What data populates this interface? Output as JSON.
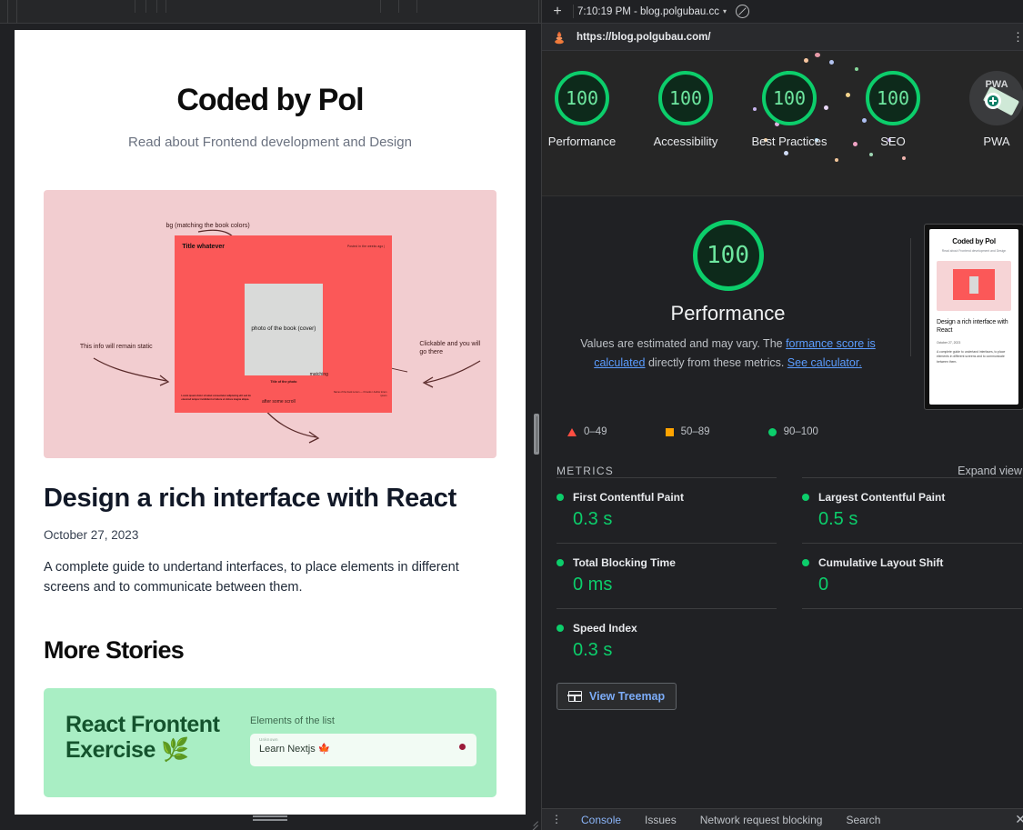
{
  "devtools": {
    "tabbar": {
      "new_tab": "+",
      "run_title": "7:10:19 PM - blog.polgubau.cc",
      "caret": "▾",
      "block_icon": "no-entry-icon"
    },
    "urlbar": {
      "url": "https://blog.polgubau.com/",
      "menu": "⋮"
    },
    "gauges": [
      {
        "score": "100",
        "label": "Performance"
      },
      {
        "score": "100",
        "label": "Accessibility"
      },
      {
        "score": "100",
        "label": "Best Practices"
      },
      {
        "score": "100",
        "label": "SEO"
      },
      {
        "score": "PWA",
        "label": "PWA"
      }
    ],
    "performance": {
      "score": "100",
      "name": "Performance",
      "desc_1": "Values are estimated and may vary. The ",
      "desc_link_1": "formance score is calculated",
      "desc_2": " directly from these metrics. ",
      "desc_link_2": "See calculator."
    },
    "legend": {
      "red": "0–49",
      "orange": "50–89",
      "green": "90–100"
    },
    "metrics_header": {
      "title": "METRICS",
      "expand": "Expand view"
    },
    "metrics": [
      {
        "name": "First Contentful Paint",
        "value": "0.3 s"
      },
      {
        "name": "Largest Contentful Paint",
        "value": "0.5 s"
      },
      {
        "name": "Total Blocking Time",
        "value": "0 ms"
      },
      {
        "name": "Cumulative Layout Shift",
        "value": "0"
      },
      {
        "name": "Speed Index",
        "value": "0.3 s"
      }
    ],
    "treemap": {
      "label": "View Treemap"
    },
    "drawer": {
      "kebab": "⋮",
      "tabs": [
        "Console",
        "Issues",
        "Network request blocking",
        "Search"
      ],
      "close": "✕"
    },
    "thumbnail": {
      "title": "Coded by Pol",
      "subtitle": "Read about Frontend development and Design",
      "post_title": "Design a rich interface with React",
      "post_date": "October 27, 2023",
      "post_body": "A complete guide to undertand interfaces, to place elements in different screens and to communicate between them."
    },
    "colors": {
      "green": "#0cce6b",
      "orange": "#ffa400",
      "red": "#ff4e42",
      "link": "#5b9dff"
    }
  },
  "page": {
    "site_title": "Coded by Pol",
    "site_subtitle": "Read about Frontend development and Design",
    "hero": {
      "annotation_top": "bg (matching the book colors)",
      "annotation_left": "This info will remain static",
      "annotation_right": "Clickable and you will go there",
      "card_title": "Title whatever",
      "card_meta": "Posted in the weeks ago |",
      "book_text": "photo of\nthe book\n(cover)",
      "caption": "Title of the photo",
      "matching": "matching",
      "mid_note": "after some scroll",
      "paragraph": "Lorem ipsum dolor sit amet consectetur adipiscing elit sed do eiusmod tempor incididunt ut labore et dolore magna aliqua.",
      "right_note": "Name of the book\nLorem — 0 books\n/ Author lorem ipsum"
    },
    "post": {
      "title": "Design a rich interface with React",
      "date": "October 27, 2023",
      "excerpt": "A complete guide to undertand interfaces, to place elements in different screens and to communicate between them."
    },
    "more_stories_heading": "More Stories",
    "story_card": {
      "title": "React Frontent Exercise 🌿",
      "widget_label": "Elements of the list",
      "input_hint": "Unknown",
      "input_value": "Learn Nextjs 🍁"
    }
  }
}
